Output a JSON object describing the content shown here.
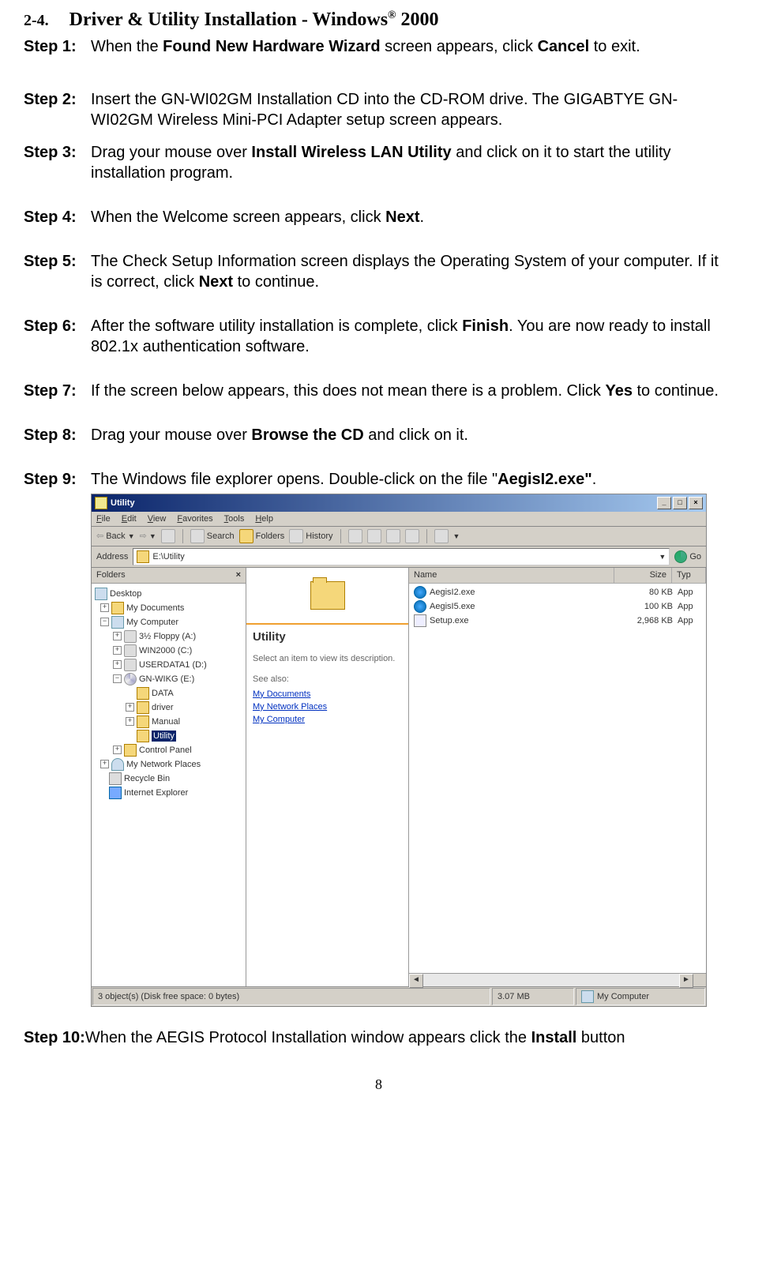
{
  "section": {
    "number": "2-4.",
    "title_a": "Driver & Utility Installation - Windows",
    "title_sup": "®",
    "title_b": " 2000"
  },
  "steps": {
    "s1": {
      "label": "Step 1:",
      "a": "When the ",
      "b1": "Found New Hardware Wizard",
      "c": " screen appears, click ",
      "b2": "Cancel",
      "d": " to exit."
    },
    "s2": {
      "label": "Step 2:",
      "text": "Insert the GN-WI02GM Installation CD into the CD-ROM drive. The GIGABTYE GN-WI02GM Wireless Mini-PCI Adapter setup screen appears."
    },
    "s3": {
      "label": "Step 3:",
      "a": "Drag your mouse over ",
      "b": "Install Wireless LAN Utility",
      "c": " and click on it to start the utility installation program."
    },
    "s4": {
      "label": "Step 4:",
      "a": "When the Welcome screen appears, click ",
      "b": "Next",
      "c": "."
    },
    "s5": {
      "label": "Step 5:",
      "a": "The Check Setup Information screen displays the Operating System of your computer. If it is correct, click ",
      "b": "Next",
      "c": " to continue."
    },
    "s6": {
      "label": "Step 6:",
      "a": "After the software utility installation is complete, click ",
      "b": "Finish",
      "c": ".    You are now ready to install 802.1x authentication software."
    },
    "s7": {
      "label": "Step 7:",
      "a": "If the screen below appears, this does not mean there is a problem. Click ",
      "b": "Yes",
      "c": " to continue."
    },
    "s8": {
      "label": "Step 8:",
      "a": "Drag your mouse over ",
      "b": "Browse the CD",
      "c": " and click on it."
    },
    "s9": {
      "label": "Step 9:",
      "a": "The Windows file explorer opens. Double-click on the file \"",
      "b": "AegisI2.exe\"",
      "c": "."
    },
    "s10": {
      "label": "Step 10:",
      "a": " When the AEGIS Protocol Installation window appears click the ",
      "b": "Install",
      "c": " button"
    }
  },
  "explorer": {
    "title": "Utility",
    "menu": {
      "file": "File",
      "edit": "Edit",
      "view": "View",
      "favorites": "Favorites",
      "tools": "Tools",
      "help": "Help"
    },
    "toolbar": {
      "back": "Back",
      "search": "Search",
      "folders": "Folders",
      "history": "History"
    },
    "address_label": "Address",
    "address_value": "E:\\Utility",
    "go": "Go",
    "folders_label": "Folders",
    "tree": {
      "desktop": "Desktop",
      "mydocuments": "My Documents",
      "mycomputer": "My Computer",
      "floppy": "3½ Floppy (A:)",
      "win2000": "WIN2000 (C:)",
      "userdata": "USERDATA1 (D:)",
      "gnwikg": "GN-WIKG (E:)",
      "data": "DATA",
      "driver": "driver",
      "manual": "Manual",
      "utility": "Utility",
      "controlpanel": "Control Panel",
      "mynetwork": "My Network Places",
      "recyclebin": "Recycle Bin",
      "ie": "Internet Explorer"
    },
    "details": {
      "heading": "Utility",
      "desc": "Select an item to view its description.",
      "seealso": "See also:",
      "link1": "My Documents",
      "link2": "My Network Places",
      "link3": "My Computer"
    },
    "cols": {
      "name": "Name",
      "size": "Size",
      "type": "Typ"
    },
    "files": [
      {
        "name": "AegisI2.exe",
        "size": "80 KB",
        "type": "App"
      },
      {
        "name": "AegisI5.exe",
        "size": "100 KB",
        "type": "App"
      },
      {
        "name": "Setup.exe",
        "size": "2,968 KB",
        "type": "App"
      }
    ],
    "status": {
      "left": "3 object(s) (Disk free space: 0 bytes)",
      "mid": "3.07 MB",
      "right": "My Computer"
    }
  },
  "page_number": "8"
}
